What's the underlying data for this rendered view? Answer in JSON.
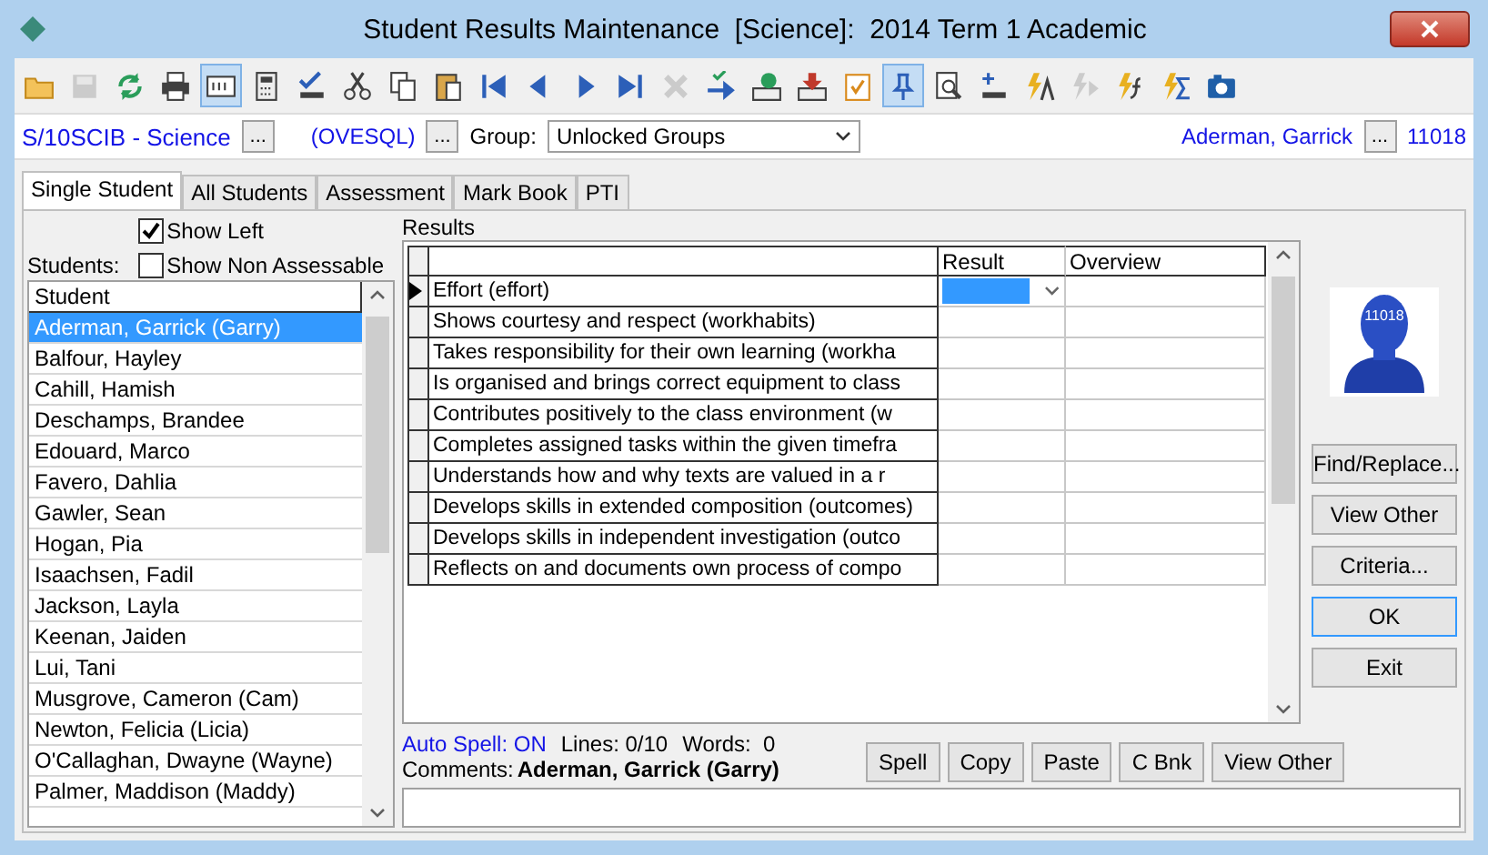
{
  "window": {
    "title": "Student Results Maintenance  [Science]:  2014 Term 1 Academic"
  },
  "toolbar": [
    {
      "pressed": false,
      "disabled": false
    },
    {
      "pressed": false,
      "disabled": true
    },
    {
      "pressed": false,
      "disabled": false
    },
    {
      "pressed": false,
      "disabled": false
    },
    {
      "pressed": true,
      "disabled": false
    },
    {
      "pressed": false,
      "disabled": false
    },
    {
      "pressed": false,
      "disabled": false
    },
    {
      "pressed": false,
      "disabled": false
    },
    {
      "pressed": false,
      "disabled": false
    },
    {
      "pressed": false,
      "disabled": false
    },
    {
      "pressed": false,
      "disabled": false
    },
    {
      "pressed": false,
      "disabled": false
    },
    {
      "pressed": false,
      "disabled": false
    },
    {
      "pressed": false,
      "disabled": false
    },
    {
      "pressed": false,
      "disabled": true
    },
    {
      "pressed": false,
      "disabled": false
    },
    {
      "pressed": false,
      "disabled": false
    },
    {
      "pressed": false,
      "disabled": false
    },
    {
      "pressed": false,
      "disabled": false
    },
    {
      "pressed": true,
      "disabled": false
    },
    {
      "pressed": false,
      "disabled": false
    },
    {
      "pressed": false,
      "disabled": false
    },
    {
      "pressed": false,
      "disabled": false
    },
    {
      "pressed": false,
      "disabled": true
    },
    {
      "pressed": false,
      "disabled": false
    },
    {
      "pressed": false,
      "disabled": false
    },
    {
      "pressed": false,
      "disabled": false
    }
  ],
  "context": {
    "class": "S/10SCIB - Science",
    "server": "(OVESQL)",
    "group_label": "Group:",
    "group": "Unlocked Groups",
    "student": "Aderman, Garrick",
    "student_id": "11018",
    "browse_buttons": [
      "...",
      "...",
      "..."
    ]
  },
  "tabs": [
    {
      "label": "Single Student",
      "selected": true
    },
    {
      "label": "All Students",
      "selected": false
    },
    {
      "label": "Assessment",
      "selected": false
    },
    {
      "label": "Mark Book",
      "selected": false
    },
    {
      "label": "PTI",
      "selected": false
    }
  ],
  "left": {
    "show_left": {
      "label": "Show Left",
      "checked": true
    },
    "students_label": "Students:",
    "show_non_assessable": {
      "label": "Show Non Assessable",
      "checked": false
    },
    "list_header": "Student",
    "students": [
      {
        "name": "Aderman, Garrick (Garry)",
        "selected": true
      },
      {
        "name": "Balfour, Hayley",
        "selected": false
      },
      {
        "name": "Cahill, Hamish",
        "selected": false
      },
      {
        "name": "Deschamps, Brandee",
        "selected": false
      },
      {
        "name": "Edouard, Marco",
        "selected": false
      },
      {
        "name": "Favero, Dahlia",
        "selected": false
      },
      {
        "name": "Gawler, Sean",
        "selected": false
      },
      {
        "name": "Hogan, Pia",
        "selected": false
      },
      {
        "name": "Isaachsen, Fadil",
        "selected": false
      },
      {
        "name": "Jackson, Layla",
        "selected": false
      },
      {
        "name": "Keenan, Jaiden",
        "selected": false
      },
      {
        "name": "Lui, Tani",
        "selected": false
      },
      {
        "name": "Musgrove, Cameron (Cam)",
        "selected": false
      },
      {
        "name": "Newton, Felicia (Licia)",
        "selected": false
      },
      {
        "name": "O'Callaghan, Dwayne (Wayne)",
        "selected": false
      },
      {
        "name": "Palmer, Maddison (Maddy)",
        "selected": false
      }
    ]
  },
  "results": {
    "label": "Results",
    "columns": [
      "Result",
      "Overview"
    ],
    "rows": [
      {
        "criterion": "Effort (effort)",
        "selected": true
      },
      {
        "criterion": "Shows courtesy and respect (workhabits)",
        "selected": false
      },
      {
        "criterion": "Takes responsibility for their own learning (workha",
        "selected": false
      },
      {
        "criterion": "Is organised and brings correct equipment to class",
        "selected": false
      },
      {
        "criterion": "Contributes positively to the class environment (w",
        "selected": false
      },
      {
        "criterion": "Completes assigned tasks within the given timefra",
        "selected": false
      },
      {
        "criterion": "Understands how and why texts are valued in a r",
        "selected": false
      },
      {
        "criterion": "Develops skills in extended composition (outcomes)",
        "selected": false
      },
      {
        "criterion": "Develops skills in independent investigation (outco",
        "selected": false
      },
      {
        "criterion": "Reflects on and documents own process of compo",
        "selected": false
      }
    ]
  },
  "avatar": {
    "number": "11018"
  },
  "side_buttons": [
    {
      "label": "Find/Replace...",
      "default": false
    },
    {
      "label": "View Other",
      "default": false
    },
    {
      "label": "Criteria...",
      "default": false
    },
    {
      "label": "OK",
      "default": true
    },
    {
      "label": "Exit",
      "default": false
    }
  ],
  "comments": {
    "auto_spell": "Auto Spell: ON",
    "lines": "Lines: 0/10",
    "words": "Words:  0",
    "label": "Comments:",
    "student": "Aderman, Garrick (Garry)",
    "buttons": [
      "Spell",
      "Copy",
      "Paste",
      "C Bnk",
      "View Other"
    ]
  }
}
